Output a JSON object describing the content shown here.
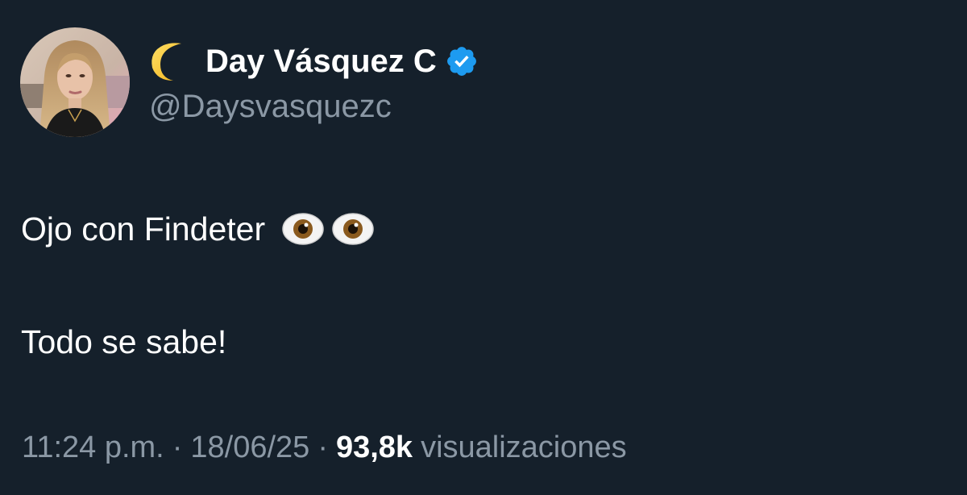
{
  "author": {
    "display_name": "Day Vásquez C",
    "handle": "@Daysvasquezc",
    "name_prefix_icon": "crescent-moon-icon",
    "verified_icon": "verified-badge-icon",
    "verified_color": "#1d9bf0"
  },
  "tweet": {
    "line_1": "Ojo con Findeter",
    "line_1_emoji": "eyes-emoji",
    "line_2": "Todo se sabe!"
  },
  "meta": {
    "time": "11:24 p.m.",
    "separator": "·",
    "date": "18/06/25",
    "views_count": "93,8k",
    "views_label": "visualizaciones"
  },
  "colors": {
    "background": "#15202b",
    "primary_text": "#ffffff",
    "secondary_text": "#8b98a5",
    "accent": "#1d9bf0"
  }
}
